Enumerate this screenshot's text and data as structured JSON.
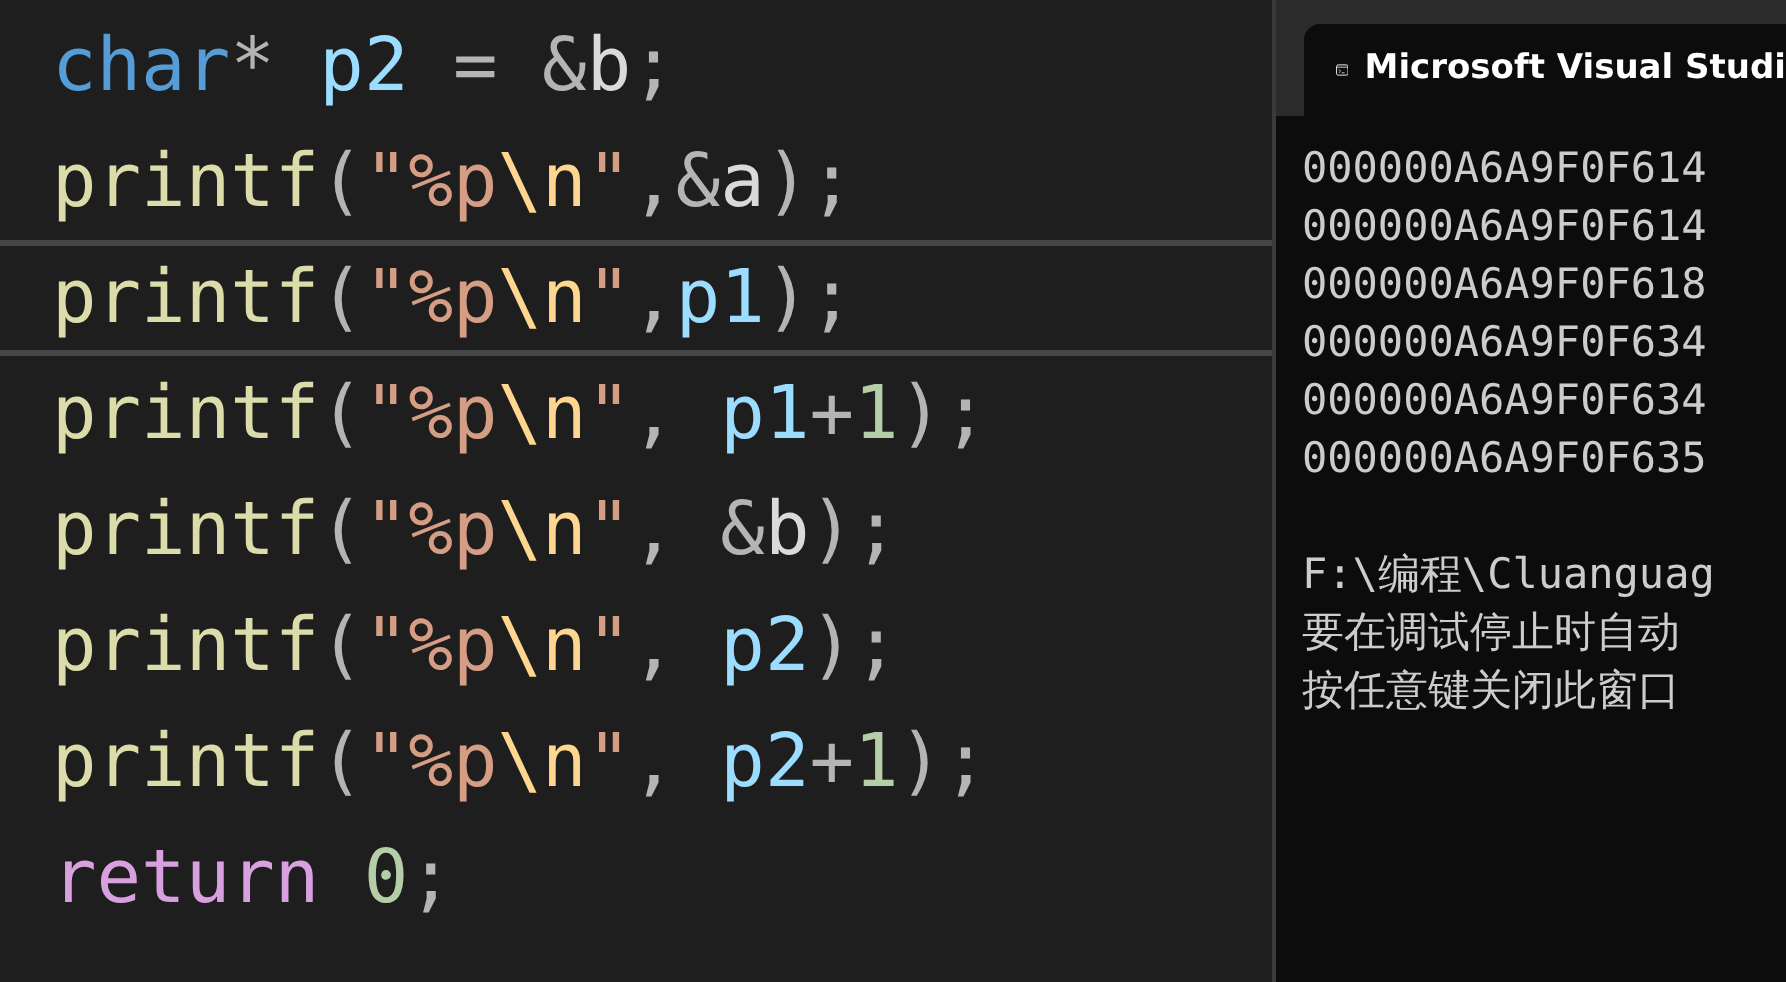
{
  "editor": {
    "lines": [
      {
        "current": false,
        "tokens": [
          {
            "kind": "type",
            "text": "char"
          },
          {
            "kind": "op",
            "text": "* "
          },
          {
            "kind": "var",
            "text": "p2"
          },
          {
            "kind": "op",
            "text": " = &"
          },
          {
            "kind": "plain",
            "text": "b"
          },
          {
            "kind": "op",
            "text": ";"
          }
        ]
      },
      {
        "current": false,
        "tokens": [
          {
            "kind": "func",
            "text": "printf"
          },
          {
            "kind": "op",
            "text": "("
          },
          {
            "kind": "string",
            "text": "\"%p"
          },
          {
            "kind": "escape",
            "text": "\\n"
          },
          {
            "kind": "string",
            "text": "\""
          },
          {
            "kind": "op",
            "text": ",&"
          },
          {
            "kind": "plain",
            "text": "a"
          },
          {
            "kind": "op",
            "text": ");"
          }
        ]
      },
      {
        "current": true,
        "tokens": [
          {
            "kind": "func",
            "text": "printf"
          },
          {
            "kind": "op",
            "text": "("
          },
          {
            "kind": "string",
            "text": "\"%p"
          },
          {
            "kind": "escape",
            "text": "\\n"
          },
          {
            "kind": "string",
            "text": "\""
          },
          {
            "kind": "op",
            "text": ","
          },
          {
            "kind": "var",
            "text": "p1"
          },
          {
            "kind": "op",
            "text": ");"
          }
        ]
      },
      {
        "current": false,
        "tokens": [
          {
            "kind": "func",
            "text": "printf"
          },
          {
            "kind": "op",
            "text": "("
          },
          {
            "kind": "string",
            "text": "\"%p"
          },
          {
            "kind": "escape",
            "text": "\\n"
          },
          {
            "kind": "string",
            "text": "\""
          },
          {
            "kind": "op",
            "text": ", "
          },
          {
            "kind": "var",
            "text": "p1"
          },
          {
            "kind": "op",
            "text": "+"
          },
          {
            "kind": "number",
            "text": "1"
          },
          {
            "kind": "op",
            "text": ");"
          }
        ]
      },
      {
        "current": false,
        "tokens": [
          {
            "kind": "func",
            "text": "printf"
          },
          {
            "kind": "op",
            "text": "("
          },
          {
            "kind": "string",
            "text": "\"%p"
          },
          {
            "kind": "escape",
            "text": "\\n"
          },
          {
            "kind": "string",
            "text": "\""
          },
          {
            "kind": "op",
            "text": ", &"
          },
          {
            "kind": "plain",
            "text": "b"
          },
          {
            "kind": "op",
            "text": ");"
          }
        ]
      },
      {
        "current": false,
        "tokens": [
          {
            "kind": "func",
            "text": "printf"
          },
          {
            "kind": "op",
            "text": "("
          },
          {
            "kind": "string",
            "text": "\"%p"
          },
          {
            "kind": "escape",
            "text": "\\n"
          },
          {
            "kind": "string",
            "text": "\""
          },
          {
            "kind": "op",
            "text": ", "
          },
          {
            "kind": "var",
            "text": "p2"
          },
          {
            "kind": "op",
            "text": ");"
          }
        ]
      },
      {
        "current": false,
        "tokens": [
          {
            "kind": "func",
            "text": "printf"
          },
          {
            "kind": "op",
            "text": "("
          },
          {
            "kind": "string",
            "text": "\"%p"
          },
          {
            "kind": "escape",
            "text": "\\n"
          },
          {
            "kind": "string",
            "text": "\""
          },
          {
            "kind": "op",
            "text": ", "
          },
          {
            "kind": "var",
            "text": "p2"
          },
          {
            "kind": "op",
            "text": "+"
          },
          {
            "kind": "number",
            "text": "1"
          },
          {
            "kind": "op",
            "text": ");"
          }
        ]
      },
      {
        "current": false,
        "tokens": [
          {
            "kind": "keyword",
            "text": "return"
          },
          {
            "kind": "number",
            "text": " 0"
          },
          {
            "kind": "op",
            "text": ";"
          }
        ]
      }
    ]
  },
  "console": {
    "title": "Microsoft Visual Studi",
    "output": [
      [
        "000000A6A9F0F614",
        "000000A6A9F0F614",
        "000000A6A9F0F618",
        "000000A6A9F0F634",
        "000000A6A9F0F634",
        "000000A6A9F0F635"
      ],
      [
        "F:\\编程\\Cluanguag",
        "要在调试停止时自动",
        "按任意键关闭此窗口"
      ]
    ]
  }
}
